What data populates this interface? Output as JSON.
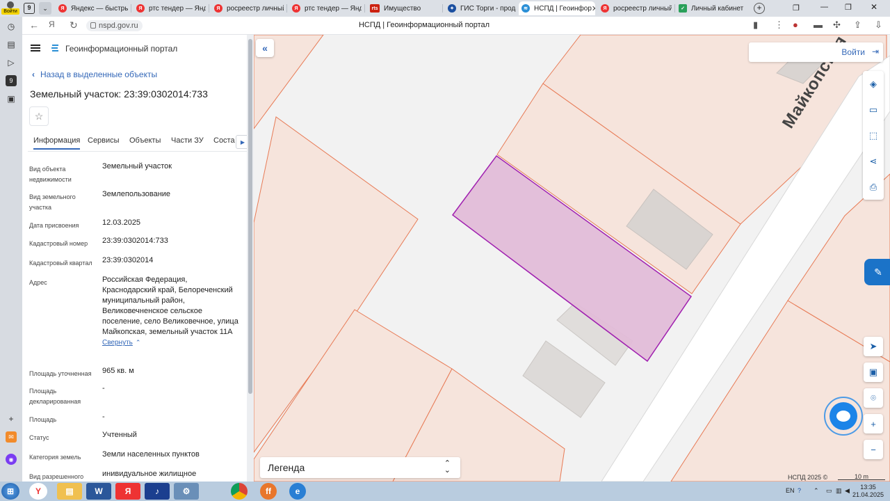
{
  "browser": {
    "tabs": [
      {
        "label": "Яндекс — быстрый",
        "icon": "yandex-icon"
      },
      {
        "label": "ртс тендер — Яндекс",
        "icon": "yandex-icon"
      },
      {
        "label": "росреестр личный",
        "icon": "yandex-icon"
      },
      {
        "label": "ртс тендер — Яндекс",
        "icon": "yandex-icon"
      },
      {
        "label": "Имущество",
        "icon": "rts-icon"
      },
      {
        "label": "ГИС Торги - продаж",
        "icon": "gis-icon"
      },
      {
        "label": "НСПД | Геоинфор",
        "icon": "nspd-icon",
        "active": true
      },
      {
        "label": "росреестр личный",
        "icon": "yandex-icon"
      },
      {
        "label": "Личный кабинет",
        "icon": "cabinet-icon"
      }
    ],
    "tab_count": "9",
    "user_label": "Войти",
    "url": "nspd.gov.ru",
    "page_title": "НСПД | Геоинформационный портал"
  },
  "site": {
    "portal_name": "Геоинформационный портал",
    "back_link": "Назад в выделенные объекты",
    "object_title": "Земельный участок: 23:39:0302014:733",
    "tabs": [
      "Информация",
      "Сервисы",
      "Объекты",
      "Части ЗУ",
      "Соста"
    ],
    "properties": [
      {
        "label": "Вид объекта недвижимости",
        "value": "Земельный участок"
      },
      {
        "label": "Вид земельного участка",
        "value": "Землепользование"
      },
      {
        "label": "Дата присвоения",
        "value": "12.03.2025"
      },
      {
        "label": "Кадастровый номер",
        "value": "23:39:0302014:733"
      },
      {
        "label": "Кадастровый квартал",
        "value": "23:39:0302014"
      },
      {
        "label": "Адрес",
        "value": "Российская Федерация, Краснодарский край, Белореченский муниципальный район, Великовечненское сельское поселение, село Великовечное, улица Майкопская, земельный участок 11А",
        "link": "Свернуть"
      },
      {
        "label": "Площадь уточненная",
        "value": "965 кв. м"
      },
      {
        "label": "Площадь декларированная",
        "value": "-"
      },
      {
        "label": "Площадь",
        "value": "-"
      },
      {
        "label": "Статус",
        "value": "Учтенный"
      },
      {
        "label": "Категория земель",
        "value": "Земли населенных пунктов"
      },
      {
        "label": "Вид разрешенного",
        "value": "инивидуальное жилищное"
      }
    ]
  },
  "map": {
    "login_label": "Войти",
    "street_label": "Майкопская",
    "legend_label": "Легенда",
    "copyright": "НСПД 2025 ©",
    "scale_label": "10 m",
    "colors": {
      "parcel_fill": "#e2bcd8",
      "parcel_stroke": "#a020b0",
      "lot_fill": "#f6e4dc",
      "lot_stroke": "#e77a55",
      "road": "#ffffff",
      "building": "#d8d4d0"
    }
  },
  "taskbar": {
    "lang": "EN",
    "time": "13:35",
    "date": "21.04.2025"
  }
}
